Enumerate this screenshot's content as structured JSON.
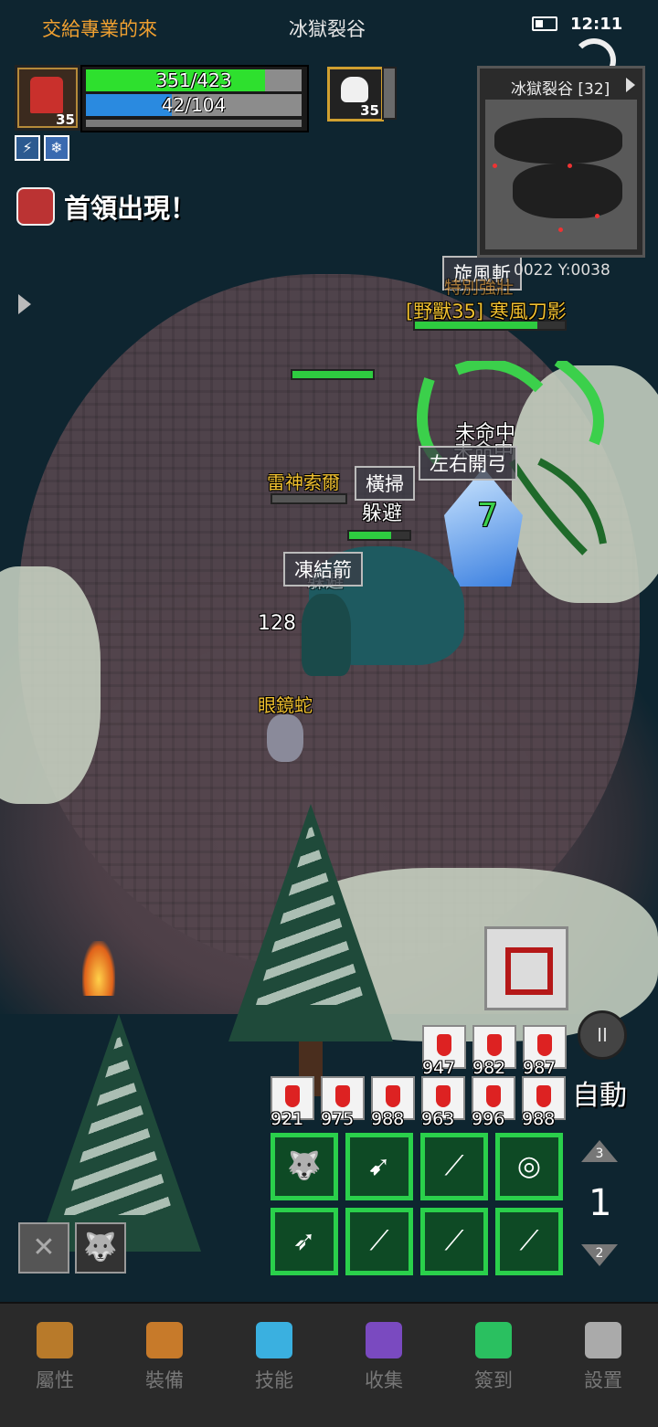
{
  "status_bar": {
    "guild": "交給專業的來",
    "zone": "冰獄裂谷",
    "time": "12:11"
  },
  "player": {
    "level": "35",
    "hp_text": "351/423",
    "hp_fraction": 0.83,
    "mp_text": "42/104",
    "mp_fraction": 0.4
  },
  "target": {
    "level": "35"
  },
  "boss_alert": "首領出現！",
  "minimap": {
    "title": "冰獄裂谷 [32]"
  },
  "coords": "0022  Y:0038",
  "floating": {
    "skill_whirlwind": "旋風斬",
    "boss_prefix": "特別強壯",
    "boss_name": "[野獸35] 寒風刀影",
    "miss1": "未命中",
    "miss2": "未命中",
    "split": "左右開弓",
    "sweep": "橫掃",
    "dodge": "躲避",
    "dodge2": "躲避",
    "ally_name": "雷神索爾",
    "freeze": "凍結箭",
    "damage": "128",
    "green_number": "7",
    "snake_name": "眼鏡蛇"
  },
  "potions_row1": [
    "947",
    "982",
    "987"
  ],
  "potions_row2": [
    "921",
    "975",
    "988",
    "963",
    "996",
    "988"
  ],
  "auto_label": "自動",
  "page": {
    "up": "3",
    "current": "1",
    "down": "2"
  },
  "nav": [
    {
      "label": "屬性",
      "color": "#b87a2a"
    },
    {
      "label": "裝備",
      "color": "#c77a2a"
    },
    {
      "label": "技能",
      "color": "#3ab0e0"
    },
    {
      "label": "收集",
      "color": "#7a4ac0"
    },
    {
      "label": "簽到",
      "color": "#2ac060"
    },
    {
      "label": "設置",
      "color": "#aaaaaa"
    }
  ]
}
